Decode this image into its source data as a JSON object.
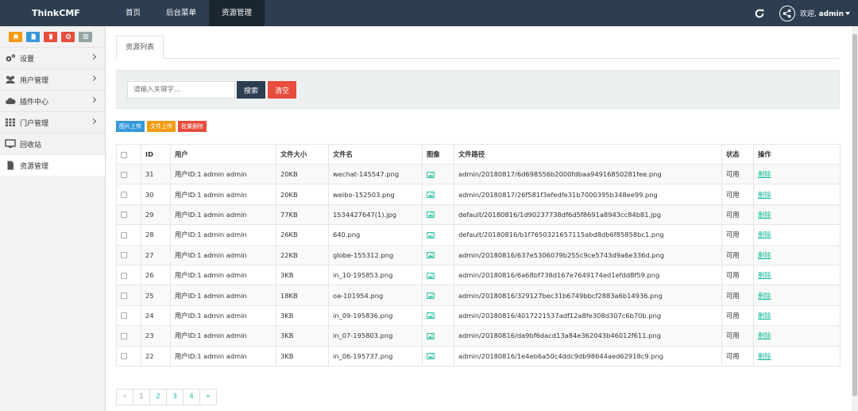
{
  "header": {
    "brand": "ThinkCMF",
    "nav": [
      {
        "label": "首页",
        "active": false
      },
      {
        "label": "后台菜单",
        "active": false
      },
      {
        "label": "资源管理",
        "active": true
      }
    ],
    "welcome_prefix": "欢迎,",
    "username": "admin"
  },
  "sidebar": {
    "shortcuts": [
      {
        "icon": "home-icon",
        "color": "#f39c12"
      },
      {
        "icon": "file-icon",
        "color": "#3498db"
      },
      {
        "icon": "trash-icon",
        "color": "#e74c3c"
      },
      {
        "icon": "recycle-icon",
        "color": "#e74c3c"
      },
      {
        "icon": "list-icon",
        "color": "#95a5a6"
      }
    ],
    "items": [
      {
        "label": "设置",
        "icon": "cogs-icon",
        "has_children": true
      },
      {
        "label": "用户管理",
        "icon": "users-icon",
        "has_children": true
      },
      {
        "label": "插件中心",
        "icon": "cloud-icon",
        "has_children": true
      },
      {
        "label": "门户管理",
        "icon": "th-icon",
        "has_children": true
      },
      {
        "label": "回收站",
        "icon": "desktop-icon",
        "has_children": false
      },
      {
        "label": "资源管理",
        "icon": "file-icon",
        "has_children": false,
        "active": true
      }
    ]
  },
  "main": {
    "tab_label": "资源列表",
    "search": {
      "placeholder": "请输入关键字...",
      "value": "",
      "search_label": "搜索",
      "clear_label": "清空"
    },
    "actions": {
      "upload_image": "图片上传",
      "upload_file": "文件上传",
      "batch_delete": "批量删除"
    },
    "table": {
      "headers": {
        "id": "ID",
        "user": "用户",
        "size": "文件大小",
        "name": "文件名",
        "image": "图像",
        "path": "文件路径",
        "status": "状态",
        "op": "操作"
      },
      "rows": [
        {
          "id": "31",
          "user": "用户ID:1 admin admin",
          "size": "20KB",
          "name": "wechat-145547.png",
          "path": "admin/20180817/6d698556b2000fdbaa94916850281fee.png",
          "status": "可用",
          "op": "删除"
        },
        {
          "id": "30",
          "user": "用户ID:1 admin admin",
          "size": "20KB",
          "name": "weibo-152503.png",
          "path": "admin/20180817/26f581f3efedfe31b7000395b348ee99.png",
          "status": "可用",
          "op": "删除"
        },
        {
          "id": "29",
          "user": "用户ID:1 admin admin",
          "size": "77KB",
          "name": "1534427647(1).jpg",
          "path": "default/20180816/1d90237738df6d5f8691a8943cc84b81.jpg",
          "status": "可用",
          "op": "删除"
        },
        {
          "id": "28",
          "user": "用户ID:1 admin admin",
          "size": "26KB",
          "name": "640.png",
          "path": "default/20180816/b1f7650321657115abd8db6f85858bc1.png",
          "status": "可用",
          "op": "删除"
        },
        {
          "id": "27",
          "user": "用户ID:1 admin admin",
          "size": "22KB",
          "name": "globe-155312.png",
          "path": "admin/20180816/637e5306079b255c9ce5743d9a6e336d.png",
          "status": "可用",
          "op": "删除"
        },
        {
          "id": "26",
          "user": "用户ID:1 admin admin",
          "size": "3KB",
          "name": "in_10-195853.png",
          "path": "admin/20180816/6a68bf738d167e7649174ed1efdd8f59.png",
          "status": "可用",
          "op": "删除"
        },
        {
          "id": "25",
          "user": "用户ID:1 admin admin",
          "size": "18KB",
          "name": "oa-101954.png",
          "path": "admin/20180816/329127bec31b6749bbcf2883a6b14936.png",
          "status": "可用",
          "op": "删除"
        },
        {
          "id": "24",
          "user": "用户ID:1 admin admin",
          "size": "3KB",
          "name": "in_09-195836.png",
          "path": "admin/20180816/4017221537adf12a8fe308d307c6b70b.png",
          "status": "可用",
          "op": "删除"
        },
        {
          "id": "23",
          "user": "用户ID:1 admin admin",
          "size": "3KB",
          "name": "in_07-195803.png",
          "path": "admin/20180816/da9bf6dacd13a84e362043b46012f611.png",
          "status": "可用",
          "op": "删除"
        },
        {
          "id": "22",
          "user": "用户ID:1 admin admin",
          "size": "3KB",
          "name": "in_06-195737.png",
          "path": "admin/20180816/1e4eb6a50c4ddc9db98644aed62918c9.png",
          "status": "可用",
          "op": "删除"
        }
      ]
    },
    "pagination": {
      "prev": "«",
      "pages": [
        "1",
        "2",
        "3",
        "4"
      ],
      "current": "1",
      "next": "»"
    }
  },
  "colors": {
    "navbar": "#2c3e50",
    "link": "#18bc9c",
    "danger": "#e74c3c",
    "primary": "#3498db",
    "warning": "#f39c12"
  }
}
